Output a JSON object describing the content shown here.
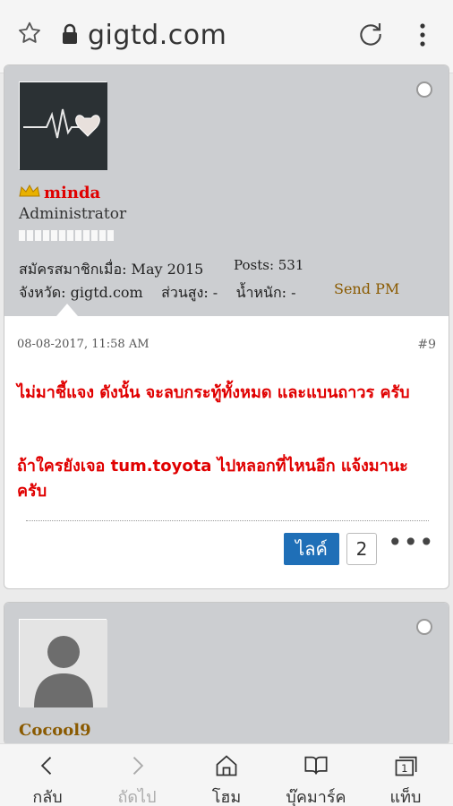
{
  "browser": {
    "url": "gigtd.com"
  },
  "post1": {
    "username": "minda",
    "role": "Administrator",
    "joined": "สมัครสมาชิกเมื่อ: May 2015",
    "posts": "Posts: 531",
    "province": "จังหวัด: gigtd.com",
    "height": "ส่วนสูง: -",
    "weight": "น้ำหนัก: -",
    "send_pm": "Send PM",
    "date": "08-08-2017, 11:58 AM",
    "number": "#9",
    "message_line1": "ไม่มาชี้แจง ดังนั้น จะลบกระทู้ทั้งหมด และแบนถาวร ครับ",
    "message_line2": "ถ้าใครยังเจอ tum.toyota ไปหลอกที่ไหนอีก แจ้งมานะ ครับ",
    "like_label": "ไลค์",
    "like_count": "2",
    "more": "•••"
  },
  "post2": {
    "username": "Cocool9"
  },
  "bottom_nav": {
    "back": "กลับ",
    "forward": "ถัดไป",
    "home": "โฮม",
    "bookmarks": "บุ๊คมาร์ค",
    "tabs": "แท็บ",
    "tab_count": "1"
  },
  "colors": {
    "accent_red": "#e00000",
    "link_brown": "#8a5a00",
    "like_blue": "#1f6fb7"
  }
}
